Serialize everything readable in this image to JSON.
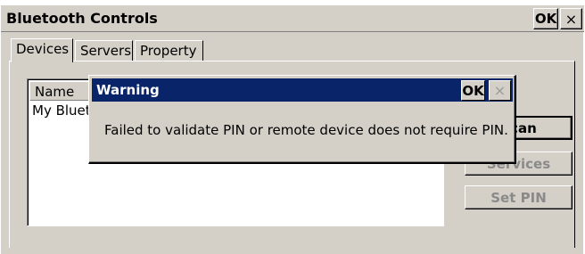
{
  "window": {
    "title": "Bluetooth Controls",
    "ok_label": "OK",
    "close_glyph": "×"
  },
  "tabs": [
    {
      "label": "Devices",
      "active": true
    },
    {
      "label": "Servers",
      "active": false
    },
    {
      "label": "Property",
      "active": false
    }
  ],
  "devices_list": {
    "column_header": "Name",
    "rows": [
      "My Bluet"
    ]
  },
  "buttons": {
    "scan": "Scan",
    "services": "Services",
    "set_pin": "Set PIN"
  },
  "dialog": {
    "title": "Warning",
    "ok_label": "OK",
    "close_glyph": "×",
    "message": "Failed to validate PIN or remote device does not require PIN."
  },
  "colors": {
    "dialog_titlebar": "#0a246a",
    "window_face": "#d4d0c8"
  }
}
